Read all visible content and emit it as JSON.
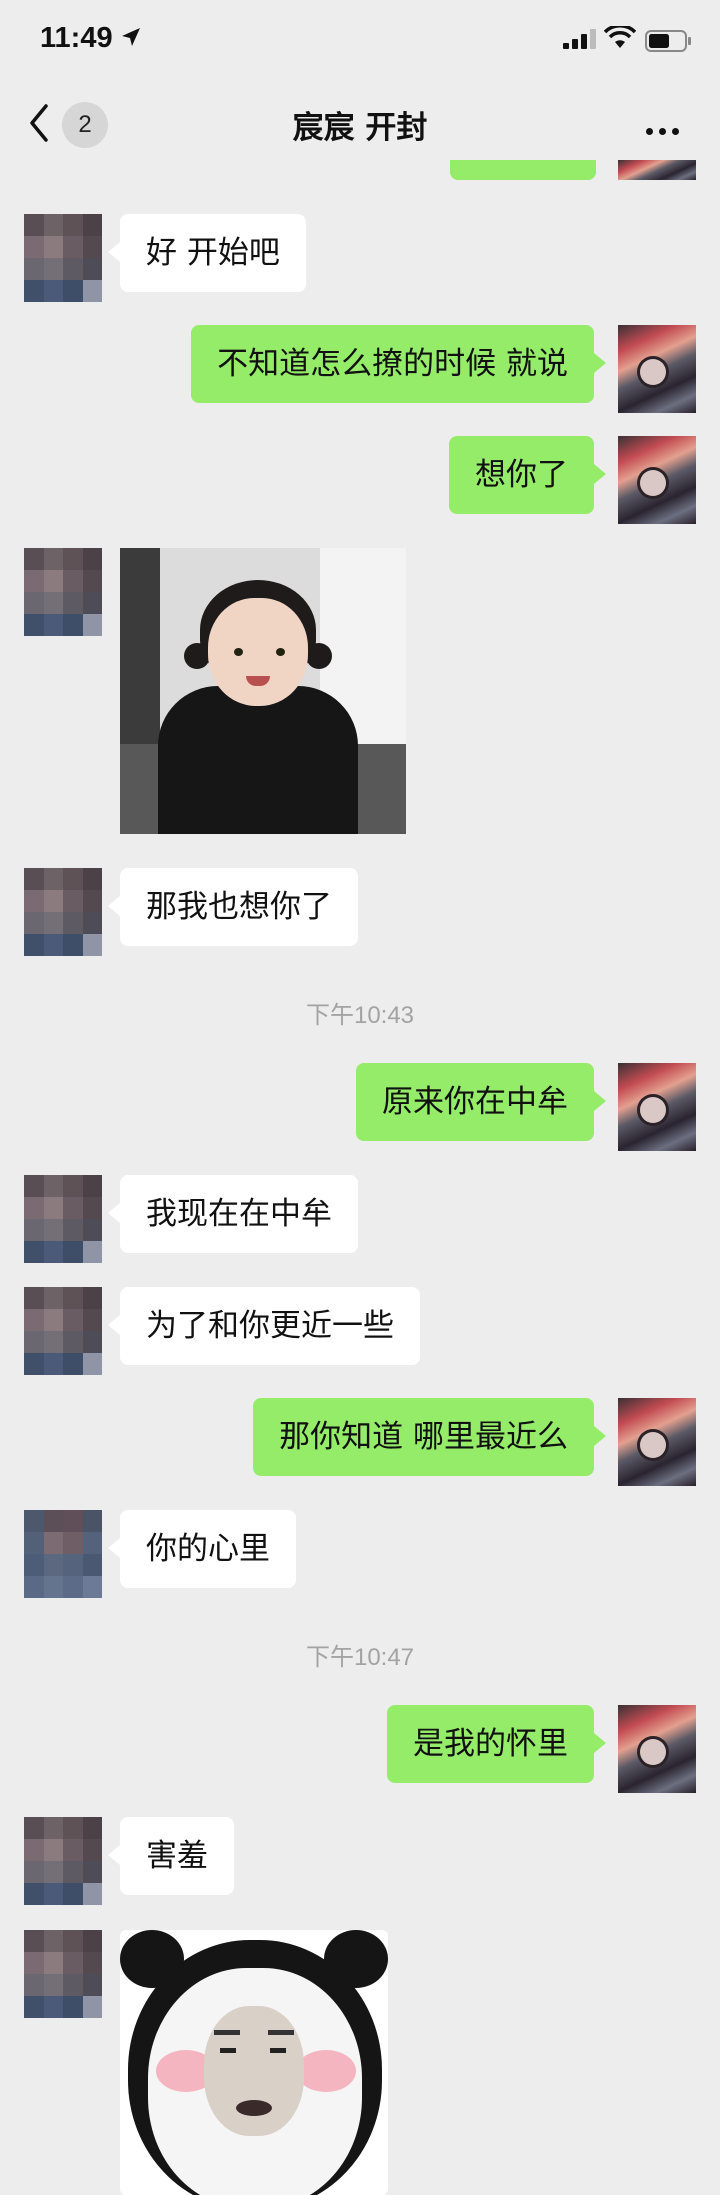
{
  "status_bar": {
    "time": "11:49"
  },
  "navbar": {
    "unread_count": "2",
    "title": "宸宸 开封"
  },
  "messages": [
    {
      "id": 0,
      "side": "other",
      "text": "好 开始吧"
    },
    {
      "id": 1,
      "side": "me",
      "text": "不知道怎么撩的时候 就说"
    },
    {
      "id": 2,
      "side": "me",
      "text": "想你了"
    },
    {
      "id": 3,
      "side": "other",
      "type": "image"
    },
    {
      "id": 4,
      "side": "other",
      "text": "那我也想你了"
    },
    {
      "id": 5,
      "type": "timestamp",
      "text": "下午10:43"
    },
    {
      "id": 6,
      "side": "me",
      "text": "原来你在中牟"
    },
    {
      "id": 7,
      "side": "other",
      "text": "我现在在中牟"
    },
    {
      "id": 8,
      "side": "other",
      "text": "为了和你更近一些"
    },
    {
      "id": 9,
      "side": "me",
      "text": "那你知道 哪里最近么"
    },
    {
      "id": 10,
      "side": "other",
      "text": "你的心里"
    },
    {
      "id": 11,
      "type": "timestamp",
      "text": "下午10:47"
    },
    {
      "id": 12,
      "side": "me",
      "text": "是我的怀里"
    },
    {
      "id": 13,
      "side": "other",
      "text": "害羞"
    },
    {
      "id": 14,
      "side": "other",
      "type": "sticker"
    }
  ]
}
